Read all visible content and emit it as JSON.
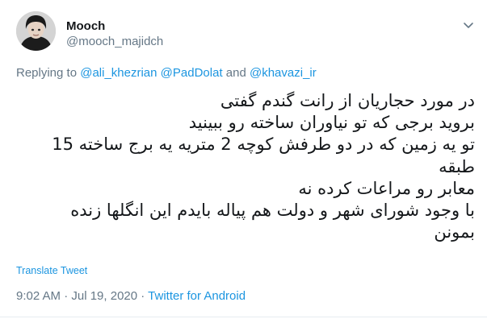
{
  "author": {
    "display_name": "Mooch",
    "handle": "@mooch_majidch",
    "avatar_icon": "profile-photo"
  },
  "reply": {
    "prefix": "Replying to ",
    "mention_1": "@ali_khezrian",
    "mention_2": "@PadDolat",
    "conjunction": " and ",
    "mention_3": "@khavazi_ir"
  },
  "tweet": {
    "lines": [
      "در مورد حجاریان از رانت گندم  گفتی",
      "بروید برجی که تو نیاوران ساخته رو ببینید",
      "تو یه زمین که در دو طرفش کوچه 2 متریه یه برج ساخته 15",
      "طبقه",
      "معابر رو مراعات کرده نه",
      "با وجود شورای شهر و دولت هم پیاله بایدم این انگلها زنده",
      "بمونن"
    ]
  },
  "translate_label": "Translate Tweet",
  "meta": {
    "timestamp": "9:02 AM · Jul 19, 2020",
    "separator": " · ",
    "source": "Twitter for Android"
  },
  "colors": {
    "link": "#1b95e0",
    "secondary_text": "#657786",
    "primary_text": "#14171a"
  },
  "icons": {
    "more": "chevron-down-icon"
  }
}
